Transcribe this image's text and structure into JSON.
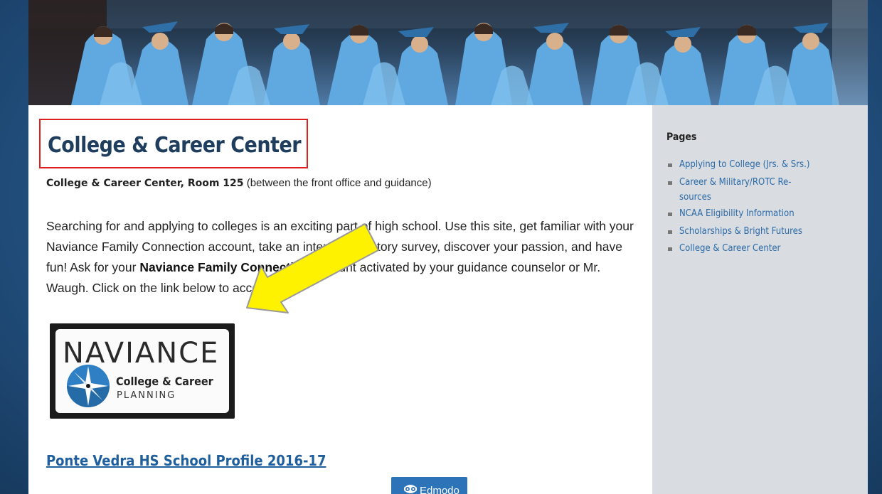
{
  "banner": {
    "alt": "Graduation ceremony photo"
  },
  "main": {
    "title": "College & Career Center",
    "room_bold": "College & Career Center, Room 125",
    "room_rest": " (between the front office and guidance)",
    "intro_part1": "Searching for and applying to colleges is an exciting part of high school.  Use this site, get familiar with your Naviance Family Connection account, take an interest inventory survey, discover your passion, and have fun!  Ask for your ",
    "intro_bold": "Naviance Family Connection",
    "intro_part2": " account activated by your guidance counselor or Mr. Waugh.  Click on the link below to access:",
    "naviance_logo": {
      "word": "NAVIANCE",
      "line1": "College & Career",
      "line2": "PLANNING"
    },
    "profile_link": "Ponte Vedra HS School Profile 2016-17",
    "edmodo_button": "Edmodo"
  },
  "sidebar": {
    "heading": "Pages",
    "items": [
      {
        "label": "Applying to College (Jrs. & Srs.)"
      },
      {
        "label": "Career & Military/ROTC Re-",
        "label_cont": "sources"
      },
      {
        "label": "NCAA Eligibility Information"
      },
      {
        "label": "Scholarships & Bright Futures"
      },
      {
        "label": "College & Career Center"
      }
    ]
  },
  "colors": {
    "title": "#1f3d5c",
    "link": "#2a6aa8",
    "highlight_box": "#e01e1e",
    "arrow": "#fff200",
    "edmodo": "#2c73b8"
  }
}
